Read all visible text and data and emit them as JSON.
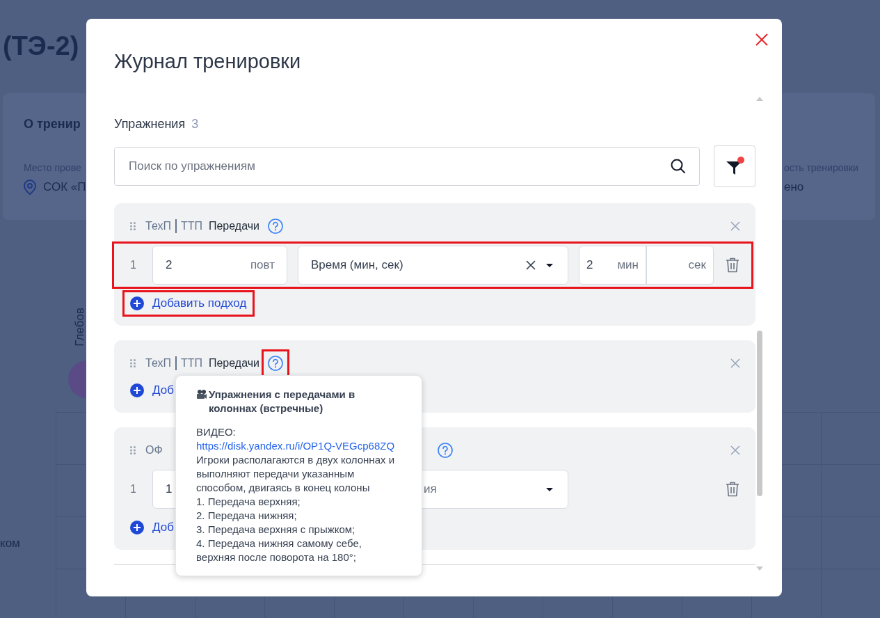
{
  "background": {
    "page_title": "(ТЭ-2)",
    "info_card": {
      "heading": "О тренир",
      "place_label": "Место прове",
      "place_value": "СОК «П",
      "status_label": "ость тренировки",
      "status_value": "ено"
    },
    "person": "Глебов",
    "row_label": "ком"
  },
  "modal": {
    "title": "Журнал тренировки",
    "section": {
      "label": "Упражнения",
      "count": "3"
    },
    "search": {
      "placeholder": "Поиск по упражнениям"
    },
    "filter": {
      "active": true
    },
    "exercises": [
      {
        "category": "ТехП",
        "subcategory": "ТТП",
        "name": "Передачи",
        "help_highlighted": false,
        "sets": [
          {
            "kind": "time",
            "number": "1",
            "reps": "2",
            "reps_unit": "повт",
            "measure": "Время (мин, сек)",
            "minutes": "2",
            "minutes_unit": "мин",
            "seconds_unit": "сек",
            "highlighted": true
          }
        ],
        "add_label": "Добавить подход",
        "add_highlighted": true
      },
      {
        "category": "ТехП",
        "subcategory": "ТТП",
        "name": "Передачи",
        "help_highlighted": true,
        "add_label": "Доб",
        "add_highlighted": false
      },
      {
        "category": "ОФ",
        "help_highlighted": false,
        "sets": [
          {
            "kind": "select",
            "number": "1",
            "reps": "1",
            "measure": "ия",
            "highlighted": false
          }
        ],
        "add_label": "Доб",
        "add_highlighted": false
      }
    ],
    "tooltip": {
      "title": "Упражнения с передачами в колоннах (встречные)",
      "video_label": "ВИДЕО:",
      "video_link": "https://disk.yandex.ru/i/OP1Q-VEGcp68ZQ",
      "description": "Игроки располагаются в двух колоннах и выполняют передачи указанным способом, двигаясь в конец колоны\n1. Передача верхняя;\n2. Передача нижняя;\n3. Передача верхняя с прыжком;\n4. Передача нижняя самому себе, верхняя после поворота на 180°;"
    }
  }
}
